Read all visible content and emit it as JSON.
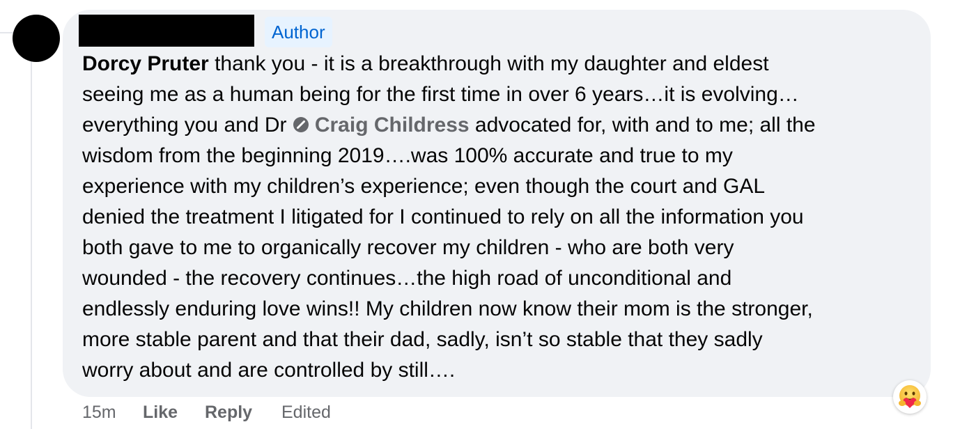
{
  "comment": {
    "badge": "Author",
    "author_mention": "Dorcy Pruter",
    "tag_name": "Craig Childress",
    "lines": {
      "l1": " thank you - it is a breakthrough with my daughter and eldest",
      "l2": "seeing me as a human being for the first time in over 6 years…it is evolving…",
      "l3a": "everything you and Dr ",
      "l3b": " advocated for, with and to me; all the",
      "l4": "wisdom from the beginning 2019….was 100% accurate and true to my",
      "l5": "experience with my children’s experience; even though the court and GAL",
      "l6": "denied the treatment I litigated for I continued to rely on all the information you",
      "l7": "both gave to me to organically recover my children - who are both very",
      "l8": "wounded - the recovery continues…the high road of unconditional and",
      "l9": "endlessly enduring love wins!! My children now know their mom is the stronger,",
      "l10": "more stable parent and that their dad, sadly, isn’t so stable that they sadly",
      "l11": "worry about and are controlled by still…."
    }
  },
  "actions": {
    "time": "15m",
    "like": "Like",
    "reply": "Reply",
    "edited": "Edited"
  },
  "reaction": {
    "icon": "care-reaction-icon"
  },
  "colors": {
    "bubble_bg": "#f0f2f5",
    "badge_bg": "#e7f3ff",
    "badge_text": "#0064d1",
    "muted_text": "#65676b",
    "body_text": "#050505"
  }
}
